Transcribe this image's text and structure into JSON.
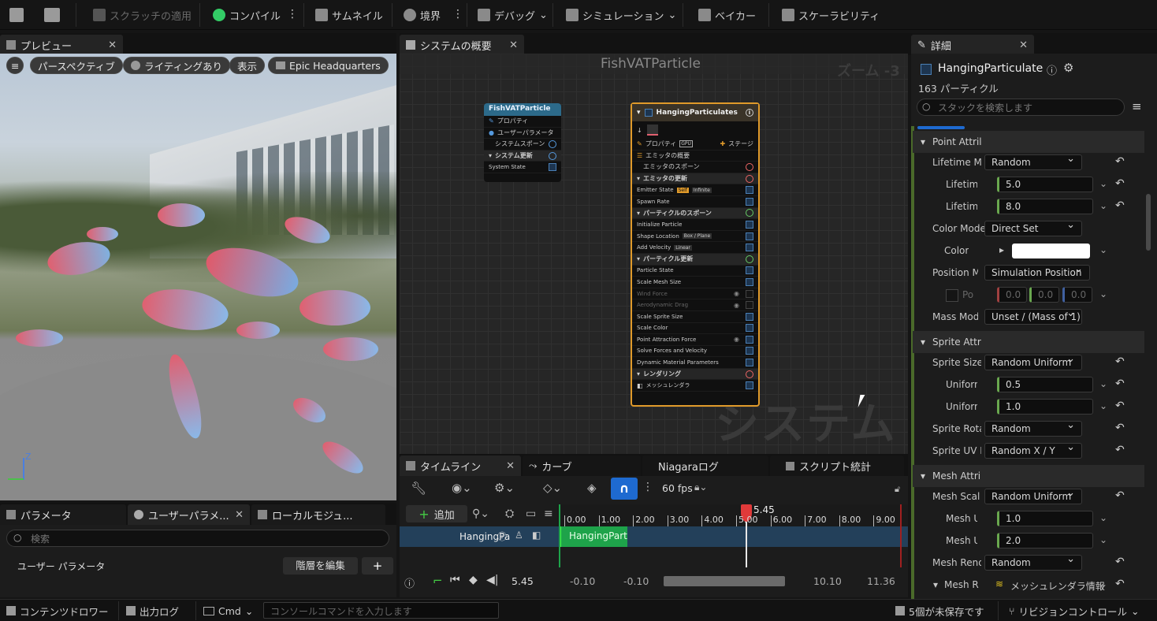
{
  "toolbar": {
    "scratch_apply": "スクラッチの適用",
    "compile": "コンパイル",
    "thumbnail": "サムネイル",
    "bounds": "境界",
    "debug": "デバッグ",
    "simulation": "シミュレーション",
    "baker": "ベイカー",
    "scalability": "スケーラビリティ"
  },
  "preview": {
    "tab": "プレビュー",
    "perspective": "パースペクティブ",
    "lighting": "ライティングあり",
    "show": "表示",
    "location": "Epic Headquarters",
    "axis_z": "Z"
  },
  "params": {
    "tab1": "パラメータ",
    "tab2": "ユーザーパラメ...",
    "tab3": "ローカルモジュ...",
    "search_placeholder": "検索",
    "section": "ユーザー パラメータ",
    "edit_hierarchy": "階層を編集",
    "add": "+"
  },
  "system_overview": {
    "tab": "システムの概要",
    "graph_title": "FishVATParticle",
    "zoom": "ズーム -3",
    "watermark": "システム",
    "system_node": {
      "title": "FishVATParticle",
      "rows": [
        "プロパティ",
        "ユーザーパラメータ",
        "システムスポーン",
        "システム更新",
        "System State"
      ]
    },
    "emitter_node": {
      "title": "HangingParticulates",
      "properties": "プロパティ",
      "stage": "ステージ",
      "summary": "エミッタの概要",
      "emitter_spawn": "エミッタのスポーン",
      "emitter_update": "エミッタの更新",
      "emitter_state": "Emitter State",
      "chip_self": "Self",
      "chip_infinite": "Infinite",
      "spawn_rate": "Spawn Rate",
      "particle_spawn": "パーティクルのスポーン",
      "initialize": "Initialize Particle",
      "shape_location": "Shape Location",
      "chip_box": "Box / Plane",
      "add_velocity": "Add Velocity",
      "chip_linear": "Linear",
      "particle_update": "パーティクル更新",
      "particle_state": "Particle State",
      "scale_mesh": "Scale Mesh Size",
      "wind_force": "Wind Force",
      "aero_drag": "Aerodynamic Drag",
      "scale_sprite": "Scale Sprite Size",
      "scale_color": "Scale Color",
      "point_attraction": "Point Attraction Force",
      "solve_forces": "Solve Forces and Velocity",
      "dynamic_material": "Dynamic Material Parameters",
      "rendering": "レンダリング",
      "mesh_renderer": "メッシュレンダラ"
    }
  },
  "timeline": {
    "tab_timeline": "タイムライン",
    "tab_curve": "カーブ",
    "tab_niagara_log": "Niagaraログ",
    "tab_script_stats": "スクリプト統計",
    "fps": "60 fps",
    "add": "追加",
    "track_name": "HangingPa",
    "track_bar": "HangingParti",
    "playhead": "5.45",
    "ticks": [
      "0.00",
      "1.00",
      "2.00",
      "3.00",
      "4.00",
      "5.00",
      "6.00",
      "7.00",
      "8.00",
      "9.00"
    ],
    "current_time": "5.45",
    "range_start1": "-0.10",
    "range_start2": "-0.10",
    "range_end1": "10.10",
    "range_end2": "11.36"
  },
  "details": {
    "tab": "詳細",
    "emitter_name": "HangingParticulate",
    "particle_count": "163 パーティクル",
    "search_placeholder": "スタックを検索します",
    "rows": {
      "point_attr": "Point Attril",
      "lifetime_mode": "Lifetime M",
      "lifetime_mode_val": "Random",
      "lifetime_min": "Lifetim",
      "lifetime_min_val": "5.0",
      "lifetime_max": "Lifetim",
      "lifetime_max_val": "8.0",
      "color_mode": "Color Mode",
      "color_mode_val": "Direct Set",
      "color": "Color",
      "position_mode": "Position M",
      "position_mode_val": "Simulation Position",
      "po": "Po",
      "po_x": "0.0",
      "po_y": "0.0",
      "po_z": "0.0",
      "mass_mode": "Mass Mod",
      "mass_mode_val": "Unset / (Mass of 1)",
      "sprite_attr": "Sprite Attr",
      "sprite_size": "Sprite Size",
      "sprite_size_val": "Random Uniform",
      "uniform_min": "Uniform",
      "uniform_min_val": "0.5",
      "uniform_max": "Uniform",
      "uniform_max_val": "1.0",
      "sprite_rot": "Sprite Rota",
      "sprite_rot_val": "Random",
      "sprite_uv": "Sprite UV I",
      "sprite_uv_val": "Random X / Y",
      "mesh_attr": "Mesh Attri",
      "mesh_scale": "Mesh Scal",
      "mesh_scale_val": "Random Uniform",
      "mesh_u1": "Mesh U",
      "mesh_u1_val": "1.0",
      "mesh_u2": "Mesh U",
      "mesh_u2_val": "2.0",
      "mesh_render": "Mesh Rend",
      "mesh_render_val": "Random",
      "mesh_r": "Mesh R",
      "mesh_r_val": "メッシュレンダラ情報"
    }
  },
  "statusbar": {
    "content_drawer": "コンテンツドロワー",
    "output_log": "出力ログ",
    "cmd": "Cmd",
    "console_placeholder": "コンソールコマンドを入力します",
    "unsaved": "5個が未保存です",
    "revision": "リビジョンコントロール"
  }
}
